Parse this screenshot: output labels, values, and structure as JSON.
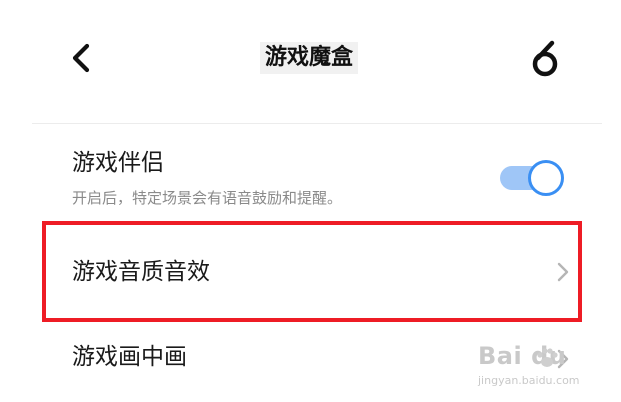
{
  "header": {
    "title": "游戏魔盒",
    "back_icon": "back-chevron-icon",
    "logo_icon": "six-logo-icon"
  },
  "settings": {
    "game_companion": {
      "label": "游戏伴侣",
      "description": "开启后，特定场景会有语音鼓励和提醒。",
      "toggle_on": true
    },
    "sound_effects": {
      "label": "游戏音质音效"
    },
    "picture_in_picture": {
      "label": "游戏画中画"
    }
  },
  "watermark": {
    "logo_text": "Bai du",
    "url": "jingyan.baidu.com"
  },
  "colors": {
    "accent": "#3a8ff3",
    "toggle_track": "#9fc6f7",
    "highlight": "#ee1c25",
    "secondary_text": "#8a8a8a"
  }
}
